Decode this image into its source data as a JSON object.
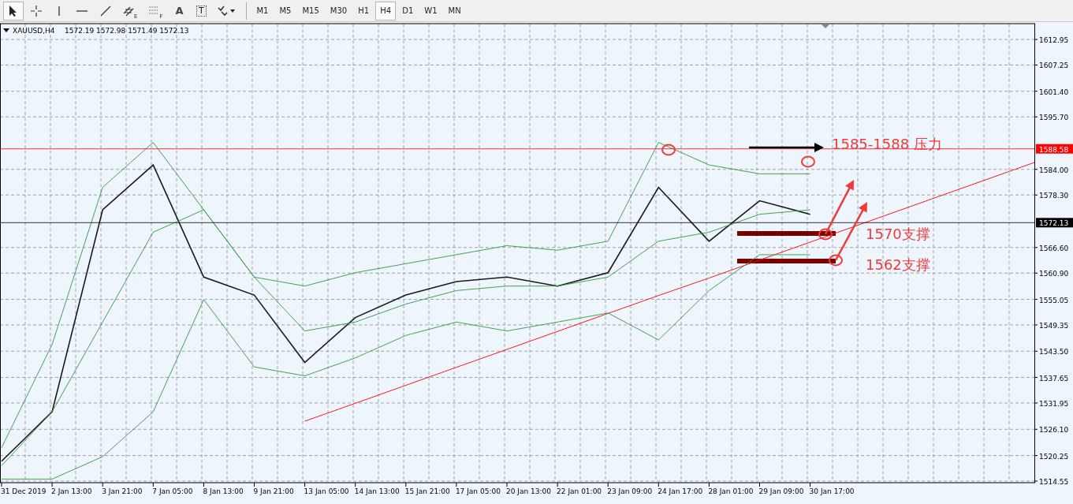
{
  "toolbar": {
    "tools": [
      {
        "kind": "cursor",
        "selected": true
      },
      {
        "kind": "crosshair",
        "selected": false
      },
      {
        "kind": "vline",
        "selected": false
      },
      {
        "kind": "hline",
        "selected": false
      },
      {
        "kind": "trendline",
        "selected": false
      },
      {
        "kind": "channel",
        "label": "E",
        "selected": false
      },
      {
        "kind": "fibo",
        "label": "F",
        "selected": false
      },
      {
        "kind": "text",
        "label": "A",
        "selected": false
      },
      {
        "kind": "textlabel",
        "label": "T",
        "selected": false
      },
      {
        "kind": "arrows",
        "selected": false
      }
    ],
    "timeframes": [
      {
        "label": "M1",
        "selected": false
      },
      {
        "label": "M5",
        "selected": false
      },
      {
        "label": "M15",
        "selected": false
      },
      {
        "label": "M30",
        "selected": false
      },
      {
        "label": "H1",
        "selected": false
      },
      {
        "label": "H4",
        "selected": true
      },
      {
        "label": "D1",
        "selected": false
      },
      {
        "label": "W1",
        "selected": false
      },
      {
        "label": "MN",
        "selected": false
      }
    ]
  },
  "chart": {
    "symbol": "XAUUSD,H4",
    "quote": "1572.19 1572.98 1571.49 1572.13",
    "chart_data": {
      "type": "line",
      "categories": [
        "31 Dec 2019",
        "2 Jan 13:00",
        "3 Jan 21:00",
        "7 Jan 05:00",
        "8 Jan 13:00",
        "9 Jan 21:00",
        "13 Jan 05:00",
        "14 Jan 13:00",
        "15 Jan 21:00",
        "17 Jan 05:00",
        "20 Jan 13:00",
        "22 Jan 01:00",
        "23 Jan 09:00",
        "24 Jan 17:00",
        "28 Jan 01:00",
        "29 Jan 09:00",
        "30 Jan 17:00"
      ],
      "ylim": [
        1514.55,
        1612.95
      ],
      "yticks": [
        {
          "value": 1612.95,
          "label": "1612.95"
        },
        {
          "value": 1607.25,
          "label": "1607.25"
        },
        {
          "value": 1601.4,
          "label": "1601.40"
        },
        {
          "value": 1595.7,
          "label": "1595.70"
        },
        {
          "value": 1584,
          "label": "1584.00"
        },
        {
          "value": 1578.3,
          "label": "1578.30"
        },
        {
          "value": 1566.6,
          "label": "1566.60"
        },
        {
          "value": 1560.9,
          "label": "1560.90"
        },
        {
          "value": 1555.05,
          "label": "1555.05"
        },
        {
          "value": 1549.35,
          "label": "1549.35"
        },
        {
          "value": 1543.5,
          "label": "1543.50"
        },
        {
          "value": 1537.65,
          "label": "1537.65"
        },
        {
          "value": 1531.95,
          "label": "1531.95"
        },
        {
          "value": 1526.1,
          "label": "1526.10"
        },
        {
          "value": 1520.25,
          "label": "1520.25"
        },
        {
          "value": 1514.55,
          "label": "1514.55"
        }
      ],
      "series": [
        {
          "color": "#1a1a1a",
          "values": [
            1519,
            1530,
            1575,
            1585,
            1560,
            1556,
            1541,
            1551,
            1556,
            1559,
            1560,
            1558,
            1561,
            1580,
            1568,
            1577,
            1574
          ]
        },
        {
          "color": "#2e9b3e",
          "values": [
            1522,
            1545,
            1580,
            1590,
            1575,
            1560,
            1558,
            1561,
            1563,
            1565,
            1567,
            1566,
            1568,
            1590,
            1585,
            1583,
            1583
          ]
        },
        {
          "color": "#2e9b3e",
          "values": [
            1518,
            1530,
            1550,
            1570,
            1575,
            1560,
            1548,
            1550,
            1554,
            1557,
            1558,
            1558,
            1560,
            1568,
            1570,
            1574,
            1575
          ]
        },
        {
          "color": "#ff0000",
          "values": [
            null,
            null,
            null,
            null,
            null,
            null,
            1527.9,
            1531.9,
            1535.9,
            1539.9,
            1543.9,
            1547.9,
            1551.9,
            1555.9,
            1559.8,
            1563.8,
            1567.8
          ]
        },
        {
          "color": "#2e9b3e",
          "values": [
            1515,
            1515,
            1520,
            1530,
            1555,
            1540,
            1538,
            1542,
            1547,
            1550,
            1548,
            1550,
            1552,
            1546,
            1557,
            1565,
            1565
          ]
        }
      ],
      "grid": true,
      "ref_lines": [
        {
          "axis": "y",
          "value": 1588.58,
          "label": "1588.58",
          "color": "#ff0000"
        },
        {
          "axis": "y",
          "value": 1572.13,
          "label": "1572.13",
          "color": "#000000"
        }
      ],
      "annotations": [
        "1585-1588 压力",
        "1570支撑",
        "1562支撑"
      ]
    }
  }
}
